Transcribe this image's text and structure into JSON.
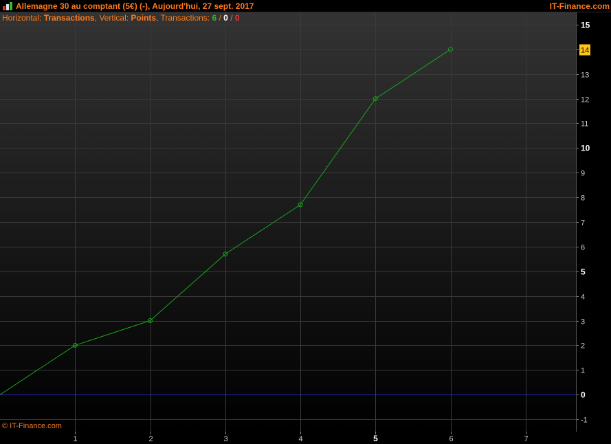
{
  "header": {
    "title": "Allemagne 30 au comptant (5€) (-), Aujourd'hui, 27 sept. 2017",
    "brand": "IT-Finance.com"
  },
  "info": {
    "horizontal_label": "Horizontal: ",
    "horizontal_value": "Transactions",
    "vertical_label": ", Vertical: ",
    "vertical_value": "Points",
    "transactions_label": ", Transactions: ",
    "transactions_total": "6",
    "sep1": " / ",
    "transactions_neutral": "0",
    "sep2": " / ",
    "transactions_losses": "0"
  },
  "watermark": "© IT-Finance.com",
  "colors": {
    "accent": "#ff7a1a",
    "line": "#1aa51a",
    "zero_line": "#2626c8",
    "highlight_bg": "#ffc61a",
    "grid": "#3a3a3a"
  },
  "chart_data": {
    "type": "line",
    "x": [
      0,
      1,
      2,
      3,
      4,
      5,
      6
    ],
    "y": [
      0,
      2,
      3,
      5.7,
      7.7,
      12,
      14
    ],
    "x_ticks": [
      "1",
      "2",
      "3",
      "4",
      "5",
      "6",
      "7"
    ],
    "x_ticks_bold": [
      "5"
    ],
    "y_ticks": [
      "15",
      "14",
      "13",
      "12",
      "11",
      "10",
      "9",
      "8",
      "7",
      "6",
      "5",
      "4",
      "3",
      "2",
      "1",
      "0",
      "-1"
    ],
    "y_ticks_bold": [
      "15",
      "10",
      "5",
      "0"
    ],
    "highlight_y": "14",
    "xlim": [
      0,
      7.67
    ],
    "ylim": [
      -1.5,
      15.5
    ],
    "grid": true
  }
}
